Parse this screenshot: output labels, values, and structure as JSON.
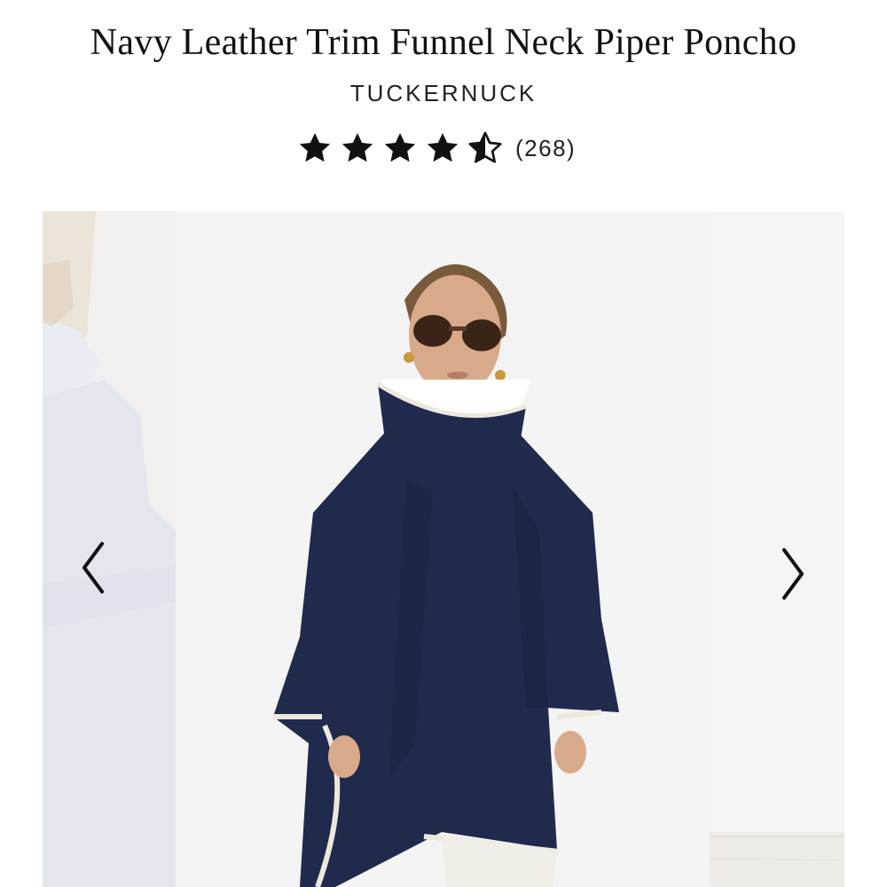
{
  "product": {
    "title": "Navy Leather Trim Funnel Neck Piper Poncho",
    "brand": "TUCKERNUCK",
    "rating_value": 4.5,
    "rating_max": 5,
    "review_count": "(268)"
  },
  "gallery": {
    "prev_icon": "chevron-left-icon",
    "next_icon": "chevron-right-icon",
    "main_image": "model-wearing-navy-poncho-photo",
    "prev_image": "previous-product-photo",
    "next_image": "next-product-photo"
  },
  "colors": {
    "text": "#111111",
    "navy": "#1f2a4d",
    "trim": "#ede8dc",
    "background": "#f4f4f4"
  }
}
